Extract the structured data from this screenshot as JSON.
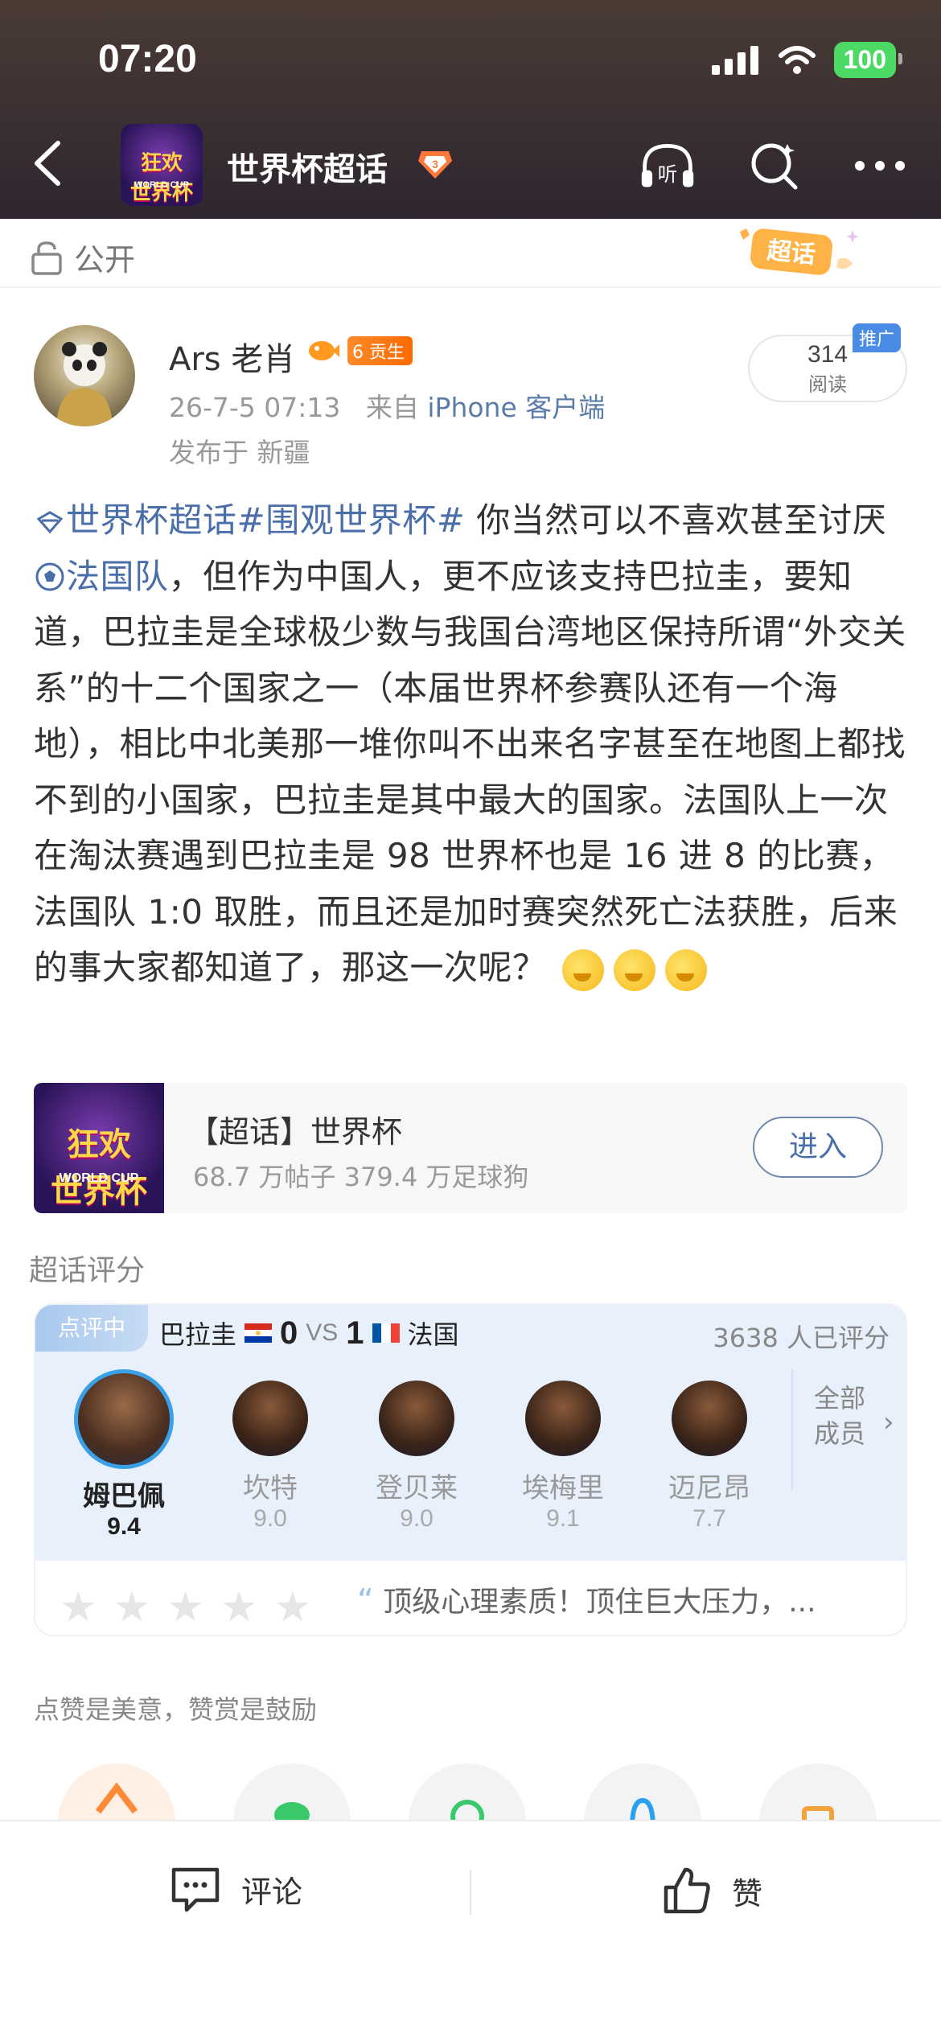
{
  "status_bar": {
    "time": "07:20",
    "battery": "100"
  },
  "nav": {
    "title": "世界杯超话",
    "group_logo": {
      "line1": "狂欢",
      "line2": "世界杯",
      "sub": "WORLD CUP"
    },
    "icons": [
      "back-icon",
      "headphones-listen-icon",
      "search-icon",
      "more-icon"
    ],
    "listen_label": "听"
  },
  "post": {
    "visibility": "公开",
    "sticker_label": "超话",
    "author": {
      "name": "Ars 老肖",
      "level": "6",
      "badge_label": "贡生"
    },
    "meta": {
      "datetime": "26-7-5 07:13",
      "from_prefix": "来自",
      "source": "iPhone 客户端"
    },
    "location": "发布于 新疆",
    "reads": {
      "count": "314",
      "label": "阅读",
      "promo": "推广"
    },
    "body": {
      "topic1": "世界杯超话",
      "topic2": "#围观世界杯#",
      "text1": " 你当然可以不喜欢甚至讨厌",
      "team_link": "法国队",
      "text2": "，但作为中国人，更不应该支持巴拉圭，要知道，巴拉圭是全球极少数与我国台湾地区保持所谓“外交关系”的十二个国家之一（本届世界杯参赛队还有一个海地），相比中北美那一堆你叫不出来名字甚至在地图上都找不到的小国家，巴拉圭是其中最大的国家。法国队上一次在淘汰赛遇到巴拉圭是 98 世界杯也是 16 进 8 的比赛，法国队 1:0 取胜，而且还是加时赛突然死亡法获胜，后来的事大家都知道了，那这一次呢？"
    }
  },
  "topic_card": {
    "title": "【超话】世界杯",
    "stats": "68.7 万帖子 379.4 万足球狗",
    "enter_label": "进入",
    "logo": {
      "line1": "狂欢",
      "line2": "世界杯",
      "sub": "WORLD CUP"
    }
  },
  "rating": {
    "section_label": "超话评分",
    "tag": "点评中",
    "team_home": "巴拉圭",
    "score_home": "0",
    "vs": "VS",
    "score_away": "1",
    "team_away": "法国",
    "rated_count": "3638 人已评分",
    "players": [
      {
        "name": "姆巴佩",
        "score": "9.4",
        "active": true
      },
      {
        "name": "坎特",
        "score": "9.0",
        "active": false
      },
      {
        "name": "登贝莱",
        "score": "9.0",
        "active": false
      },
      {
        "name": "埃梅里",
        "score": "9.1",
        "active": false
      },
      {
        "name": "迈尼昂",
        "score": "7.7",
        "active": false
      }
    ],
    "all_members": "全部成员",
    "user_stars": 0,
    "review_snippet": "顶级心理素质！顶住巨大压力，..."
  },
  "tip": {
    "label": "点赞是美意，赞赏是鼓励"
  },
  "bottom_bar": {
    "comment_label": "评论",
    "like_label": "赞"
  },
  "colors": {
    "topic_link": "#4a6ea9",
    "header_bg": "#3a2f32",
    "battery_green": "#4cd964",
    "active_ring": "#3aa0e8"
  }
}
